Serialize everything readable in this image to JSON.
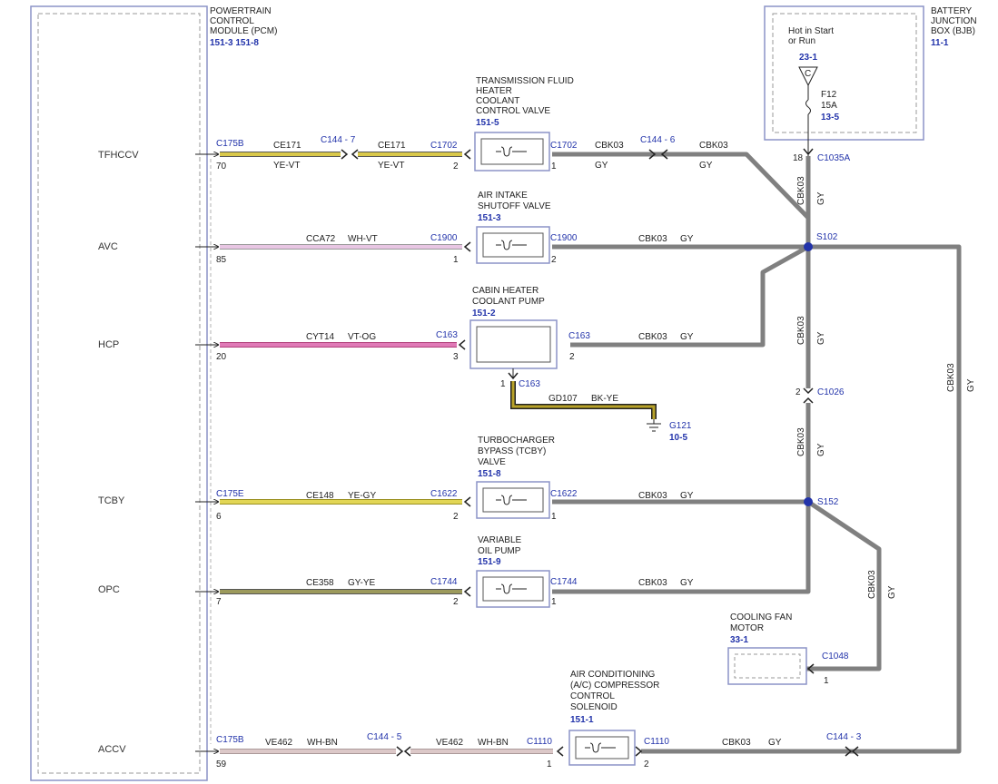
{
  "pcm": {
    "title": [
      "POWERTRAIN",
      "CONTROL",
      "MODULE (PCM)"
    ],
    "refs": "151-3   151-8",
    "signals": [
      "TFHCCV",
      "AVC",
      "HCP",
      "TCBY",
      "OPC",
      "ACCV"
    ]
  },
  "bjb": {
    "title": [
      "BATTERY",
      "JUNCTION",
      "BOX (BJB)"
    ],
    "ref": "11-1",
    "hot_text": [
      "Hot in Start",
      "or Run"
    ],
    "hot_ref": "23-1",
    "c_label": "C",
    "fuse_name": "F12",
    "fuse_rating": "15A",
    "fuse_ref": "13-5",
    "pin": "18",
    "connector": "C1035A"
  },
  "components": {
    "tfhccv": {
      "title": [
        "TRANSMISSION FLUID",
        "HEATER",
        "COOLANT",
        "CONTROL VALVE"
      ],
      "ref": "151-5"
    },
    "air_intake": {
      "title": [
        "AIR INTAKE",
        "SHUTOFF VALVE"
      ],
      "ref": "151-3"
    },
    "cabin_pump": {
      "title": [
        "CABIN HEATER",
        "COOLANT PUMP"
      ],
      "ref": "151-2"
    },
    "tcby": {
      "title": [
        "TURBOCHARGER",
        "BYPASS (TCBY)",
        "VALVE"
      ],
      "ref": "151-8"
    },
    "oil_pump": {
      "title": [
        "VARIABLE",
        "OIL PUMP"
      ],
      "ref": "151-9"
    },
    "fan": {
      "title": [
        "COOLING FAN",
        "MOTOR"
      ],
      "ref": "33-1"
    },
    "ac": {
      "title": [
        "AIR CONDITIONING",
        "(A/C) COMPRESSOR",
        "CONTROL",
        "SOLENOID"
      ],
      "ref": "151-1"
    }
  },
  "wires": {
    "tfhccv": {
      "conn_pcm": "C175B",
      "pin_pcm": "70",
      "circuit1": "CE171",
      "color1": "YE-VT",
      "inline": "C144 - 7",
      "circuit2": "CE171",
      "color2": "YE-VT",
      "conn_dev": "C1702",
      "pin_dev": "2",
      "conn_out": "C1702",
      "pin_out": "1",
      "circuit3": "CBK03",
      "color3": "GY",
      "inline2": "C144 - 6",
      "circuit4": "CBK03",
      "color4": "GY"
    },
    "avc": {
      "pin_pcm": "85",
      "circuit": "CCA72",
      "color": "WH-VT",
      "conn_dev": "C1900",
      "pin_dev": "1",
      "conn_out": "C1900",
      "pin_out": "2",
      "circuit_out": "CBK03",
      "color_out": "GY"
    },
    "hcp": {
      "pin_pcm": "20",
      "circuit": "CYT14",
      "color": "VT-OG",
      "conn_dev": "C163",
      "pin_dev": "3",
      "conn_out": "C163",
      "pin_out": "2",
      "circuit_out": "CBK03",
      "color_out": "GY",
      "gnd_pin": "1",
      "gnd_conn": "C163",
      "gnd_circuit": "GD107",
      "gnd_color": "BK-YE",
      "ground": "G121",
      "ground_ref": "10-5"
    },
    "tcby": {
      "conn_pcm": "C175E",
      "pin_pcm": "6",
      "circuit": "CE148",
      "color": "YE-GY",
      "conn_dev": "C1622",
      "pin_dev": "2",
      "conn_out": "C1622",
      "pin_out": "1",
      "circuit_out": "CBK03",
      "color_out": "GY"
    },
    "opc": {
      "pin_pcm": "7",
      "circuit": "CE358",
      "color": "GY-YE",
      "conn_dev": "C1744",
      "pin_dev": "2",
      "conn_out": "C1744",
      "pin_out": "1",
      "circuit_out": "CBK03",
      "color_out": "GY"
    },
    "accv": {
      "conn_pcm": "C175B",
      "pin_pcm": "59",
      "circuit1": "VE462",
      "color1": "WH-BN",
      "inline": "C144 - 5",
      "circuit2": "VE462",
      "color2": "WH-BN",
      "conn_dev": "C1110",
      "pin_dev": "1",
      "conn_out": "C1110",
      "pin_out": "2",
      "circuit_out": "CBK03",
      "color_out": "GY",
      "inline2": "C144 - 3"
    }
  },
  "feed": {
    "splice1": "S102",
    "splice2": "S152",
    "vert1_circuit": "CBK03",
    "vert1_color": "GY",
    "vert2_circuit": "CBK03",
    "vert2_color": "GY",
    "c1026_pin": "2",
    "c1026": "C1026",
    "vert3_circuit": "CBK03",
    "vert3_color": "GY",
    "right_circuit": "CBK03",
    "right_color": "GY",
    "fan_circuit": "CBK03",
    "fan_color": "GY",
    "fan_conn": "C1048",
    "fan_pin": "1"
  },
  "colors": {
    "ye_vt": "#d9c84a",
    "wh_vt": "#e8c6e3",
    "vt_og": "#e07ab7",
    "ye_gy": "#e2d655",
    "gy_ye": "#9c9a5c",
    "wh_bn": "#dcc8c8",
    "gy": "#808080",
    "bk_ye": "#b8a228",
    "blue": "#2233aa"
  }
}
